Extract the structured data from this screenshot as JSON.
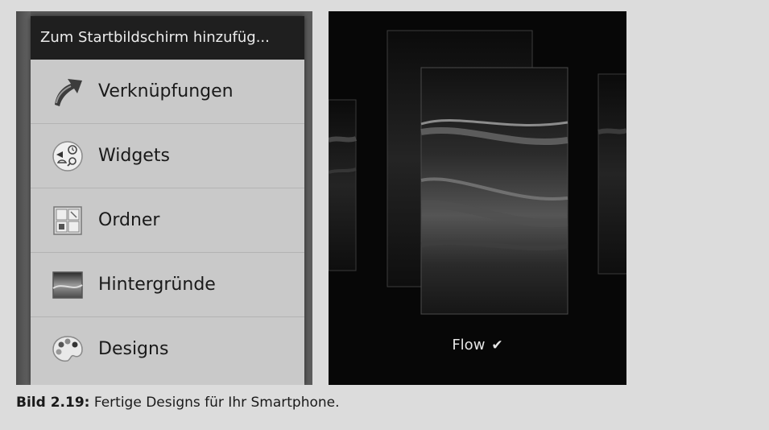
{
  "menu": {
    "title": "Zum Startbildschirm hinzufüg...",
    "items": [
      {
        "label": "Verknüpfungen",
        "icon": "shortcut-arrow-icon"
      },
      {
        "label": "Widgets",
        "icon": "widgets-icon"
      },
      {
        "label": "Ordner",
        "icon": "folder-grid-icon"
      },
      {
        "label": "Hintergründe",
        "icon": "wallpaper-icon"
      },
      {
        "label": "Designs",
        "icon": "palette-icon"
      }
    ]
  },
  "theme_picker": {
    "selected_theme": "Flow",
    "check_glyph": "✔"
  },
  "caption": {
    "label": "Bild 2.19:",
    "text": " Fertige Designs für Ihr Smartphone."
  }
}
